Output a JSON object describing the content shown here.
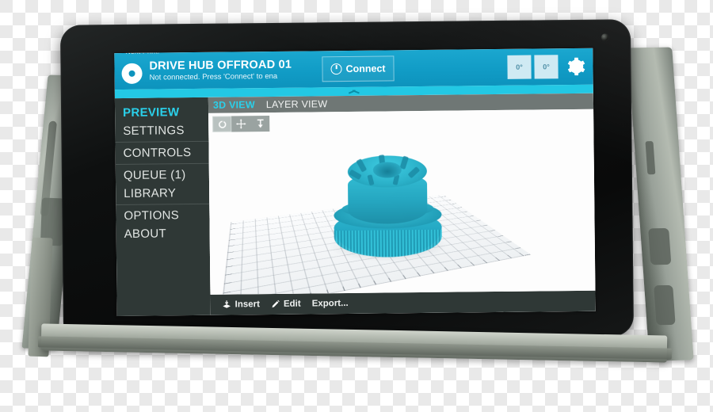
{
  "header": {
    "next_print_label": "Next Print:",
    "job_name": "DRIVE HUB OFFROAD 01",
    "job_status": "Not connected. Press 'Connect' to ena",
    "connect_label": "Connect",
    "temp_buttons": [
      "0°",
      "0°"
    ],
    "gear_icon": "gear-icon",
    "disc_icon": "print-disc-icon",
    "power_icon": "power-icon",
    "accent_color": "#119cc6",
    "strip_color": "#23c8e4"
  },
  "sidebar": {
    "groups": [
      {
        "items": [
          {
            "label": "PREVIEW",
            "active": true
          },
          {
            "label": "SETTINGS",
            "active": false
          }
        ]
      },
      {
        "items": [
          {
            "label": "CONTROLS",
            "active": false
          }
        ]
      },
      {
        "items": [
          {
            "label": "QUEUE (1)",
            "active": false
          },
          {
            "label": "LIBRARY",
            "active": false
          }
        ]
      },
      {
        "items": [
          {
            "label": "OPTIONS",
            "active": false
          },
          {
            "label": "ABOUT",
            "active": false
          }
        ]
      }
    ],
    "active_color": "#2ad0ea",
    "background": "#2f3836"
  },
  "tabs": [
    {
      "label": "3D VIEW",
      "active": true
    },
    {
      "label": "LAYER VIEW",
      "active": false
    }
  ],
  "viewport": {
    "tools": [
      {
        "name": "rotate-tool",
        "selected": true
      },
      {
        "name": "move-tool",
        "selected": false
      },
      {
        "name": "scale-tool",
        "selected": false
      }
    ],
    "model_name": "drive-hub-model",
    "model_color": "#29b0c8",
    "bed_name": "build-plate-grid"
  },
  "actionbar": {
    "insert_label": "Insert",
    "edit_label": "Edit",
    "export_label": "Export..."
  },
  "navbar": {
    "buttons": [
      "volume-down-icon",
      "back-icon",
      "home-icon",
      "recents-icon",
      "volume-up-icon",
      "overflow-menu-icon"
    ]
  },
  "device": {
    "camera": "front-camera",
    "mount_left": "printer-mount-left",
    "mount_right": "printer-mount-right",
    "mount_base": "printer-mount-base"
  }
}
